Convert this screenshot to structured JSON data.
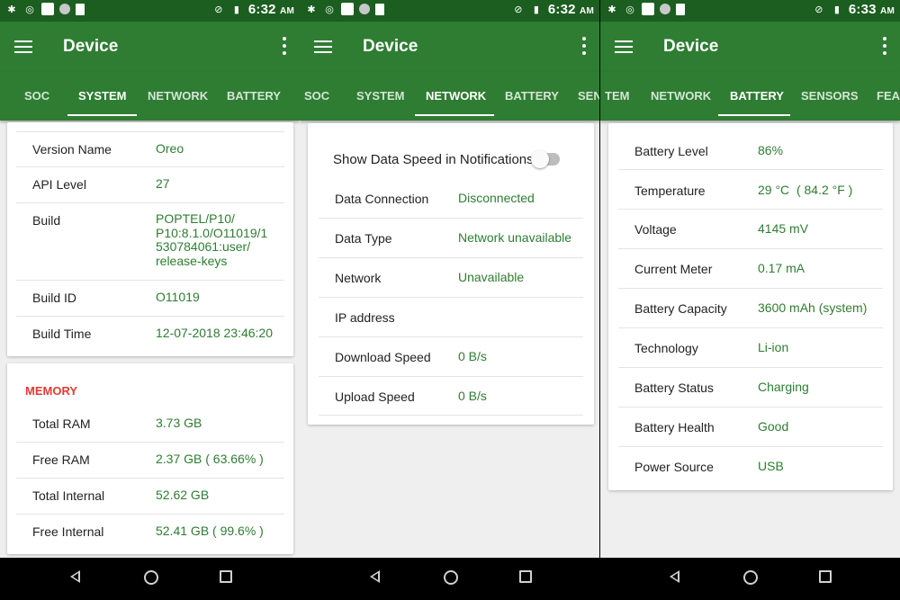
{
  "status_bars": [
    {
      "time": "6:32",
      "ampm": "AM"
    },
    {
      "time": "6:32",
      "ampm": "AM"
    },
    {
      "time": "6:33",
      "ampm": "AM"
    }
  ],
  "app": {
    "title": "Device"
  },
  "panels": [
    {
      "tabs": [
        "SOC",
        "SYSTEM",
        "NETWORK",
        "BATTERY"
      ],
      "active_tab": "SYSTEM",
      "system_rows": [
        {
          "label": "Version Name",
          "value": "Oreo"
        },
        {
          "label": "API Level",
          "value": "27"
        },
        {
          "label": "Build",
          "value": "POPTEL/P10/\nP10:8.1.0/O11019/1\n530784061:user/\nrelease-keys"
        },
        {
          "label": "Build ID",
          "value": "O11019"
        },
        {
          "label": "Build Time",
          "value": "12-07-2018 23:46:20"
        }
      ],
      "memory_title": "MEMORY",
      "memory_rows": [
        {
          "label": "Total RAM",
          "value": "3.73 GB"
        },
        {
          "label": "Free RAM",
          "value": "2.37 GB ( 63.66% )"
        },
        {
          "label": "Total Internal",
          "value": "52.62 GB"
        },
        {
          "label": "Free Internal",
          "value": "52.41 GB ( 99.6% )"
        }
      ]
    },
    {
      "tabs": [
        "SOC",
        "SYSTEM",
        "NETWORK",
        "BATTERY",
        "SEN"
      ],
      "active_tab": "NETWORK",
      "toggle_label": "Show Data Speed in Notifications",
      "toggle_on": false,
      "network_rows": [
        {
          "label": "Data Connection",
          "value": "Disconnected"
        },
        {
          "label": "Data Type",
          "value": "Network unavailable"
        },
        {
          "label": "Network",
          "value": "Unavailable"
        },
        {
          "label": "IP address",
          "value": ""
        },
        {
          "label": "Download Speed",
          "value": "0 B/s"
        },
        {
          "label": "Upload Speed",
          "value": "0 B/s"
        }
      ]
    },
    {
      "tabs": [
        "TEM",
        "NETWORK",
        "BATTERY",
        "SENSORS",
        "FEA"
      ],
      "active_tab": "BATTERY",
      "battery_rows": [
        {
          "label": "Battery Level",
          "value": "86%"
        },
        {
          "label": "Temperature",
          "value": "29 °C  ( 84.2 °F )"
        },
        {
          "label": "Voltage",
          "value": "4145 mV"
        },
        {
          "label": "Current Meter",
          "value": "0.17 mA"
        },
        {
          "label": "Battery Capacity",
          "value": "3600 mAh (system)"
        },
        {
          "label": "Technology",
          "value": "Li-ion"
        },
        {
          "label": "Battery Status",
          "value": "Charging"
        },
        {
          "label": "Battery Health",
          "value": "Good"
        },
        {
          "label": "Power Source",
          "value": "USB"
        }
      ]
    }
  ]
}
